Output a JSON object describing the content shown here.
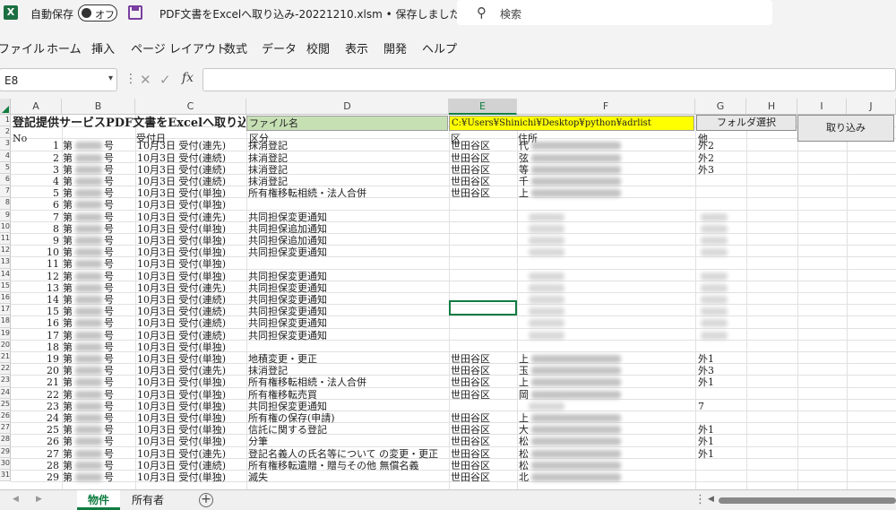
{
  "titlebar": {
    "app_icon": "excel-icon",
    "autosave_label": "自動保存",
    "autosave_state": "オフ",
    "save_icon": "save-icon",
    "document_title": "PDF文書をExcelへ取り込み-20221210.xlsm • 保存しました ∨",
    "search_placeholder": "検索"
  },
  "menu": [
    "ファイル",
    "ホーム",
    "挿入",
    "ページ レイアウト",
    "数式",
    "データ",
    "校閲",
    "表示",
    "開発",
    "ヘルプ"
  ],
  "formula_bar": {
    "name_box": "E8",
    "formula": ""
  },
  "columns": [
    "A",
    "B",
    "C",
    "D",
    "E",
    "F",
    "G",
    "H",
    "I",
    "J"
  ],
  "selected_column": "E",
  "row_numbers": [
    "1",
    "2",
    "3",
    "4",
    "5",
    "6",
    "7",
    "8",
    "9",
    "10",
    "11",
    "12",
    "13",
    "14",
    "15",
    "16",
    "17",
    "18",
    "19",
    "20",
    "21",
    "22",
    "23",
    "24",
    "25",
    "26",
    "27",
    "28",
    "29",
    "30",
    "31"
  ],
  "sheet": {
    "title": "登記提供サービスPDF文書をExcelへ取り込み",
    "filename_label": "ファイル名",
    "path_value": "C:¥Users¥Shinichi¥Desktop¥python¥adrlist",
    "folder_button": "フォルダ選択",
    "import_button": "取り込み",
    "headers": {
      "no": "No",
      "receipt": "受付日",
      "category": "区分",
      "ward": "区",
      "address": "住所",
      "other": "他"
    },
    "rows": [
      {
        "no": "1",
        "prefix": "第",
        "suffix": "号",
        "date": "10月3日 受付(連先)",
        "category": "抹消登記",
        "ward": "世田谷区",
        "addr": "代",
        "other": "外2"
      },
      {
        "no": "2",
        "prefix": "第",
        "suffix": "号",
        "date": "10月3日 受付(連続)",
        "category": "抹消登記",
        "ward": "世田谷区",
        "addr": "弦",
        "other": "外2"
      },
      {
        "no": "3",
        "prefix": "第",
        "suffix": "号",
        "date": "10月3日 受付(連続)",
        "category": "抹消登記",
        "ward": "世田谷区",
        "addr": "等",
        "other": "外3"
      },
      {
        "no": "4",
        "prefix": "第",
        "suffix": "号",
        "date": "10月3日 受付(連続)",
        "category": "抹消登記",
        "ward": "世田谷区",
        "addr": "千",
        "other": ""
      },
      {
        "no": "5",
        "prefix": "第",
        "suffix": "号",
        "date": "10月3日 受付(単独)",
        "category": "所有権移転相続・法人合併",
        "ward": "世田谷区",
        "addr": "上",
        "other": ""
      },
      {
        "no": "6",
        "prefix": "第",
        "suffix": "号",
        "date": "10月3日 受付(単独)",
        "category": "",
        "ward": "",
        "addr": "",
        "other": ""
      },
      {
        "no": "7",
        "prefix": "第",
        "suffix": "号",
        "date": "10月3日 受付(連先)",
        "category": "共同担保変更通知",
        "ward": "",
        "addr": "",
        "other": ""
      },
      {
        "no": "8",
        "prefix": "第",
        "suffix": "号",
        "date": "10月3日 受付(単独)",
        "category": "共同担保追加通知",
        "ward": "",
        "addr": "",
        "other": ""
      },
      {
        "no": "9",
        "prefix": "第",
        "suffix": "号",
        "date": "10月3日 受付(単独)",
        "category": "共同担保追加通知",
        "ward": "",
        "addr": "",
        "other": ""
      },
      {
        "no": "10",
        "prefix": "第",
        "suffix": "号",
        "date": "10月3日 受付(単独)",
        "category": "共同担保変更通知",
        "ward": "",
        "addr": "",
        "other": ""
      },
      {
        "no": "11",
        "prefix": "第",
        "suffix": "号",
        "date": "10月3日 受付(単独)",
        "category": "",
        "ward": "",
        "addr": "",
        "other": ""
      },
      {
        "no": "12",
        "prefix": "第",
        "suffix": "号",
        "date": "10月3日 受付(単独)",
        "category": "共同担保変更通知",
        "ward": "",
        "addr": "",
        "other": ""
      },
      {
        "no": "13",
        "prefix": "第",
        "suffix": "号",
        "date": "10月3日 受付(連先)",
        "category": "共同担保変更通知",
        "ward": "",
        "addr": "",
        "other": ""
      },
      {
        "no": "14",
        "prefix": "第",
        "suffix": "号",
        "date": "10月3日 受付(連続)",
        "category": "共同担保変更通知",
        "ward": "",
        "addr": "",
        "other": ""
      },
      {
        "no": "15",
        "prefix": "第",
        "suffix": "号",
        "date": "10月3日 受付(連続)",
        "category": "共同担保変更通知",
        "ward": "",
        "addr": "",
        "other": ""
      },
      {
        "no": "16",
        "prefix": "第",
        "suffix": "号",
        "date": "10月3日 受付(連続)",
        "category": "共同担保変更通知",
        "ward": "",
        "addr": "",
        "other": ""
      },
      {
        "no": "17",
        "prefix": "第",
        "suffix": "号",
        "date": "10月3日 受付(連続)",
        "category": "共同担保変更通知",
        "ward": "",
        "addr": "",
        "other": ""
      },
      {
        "no": "18",
        "prefix": "第",
        "suffix": "号",
        "date": "10月3日 受付(単独)",
        "category": "",
        "ward": "",
        "addr": "",
        "other": ""
      },
      {
        "no": "19",
        "prefix": "第",
        "suffix": "号",
        "date": "10月3日 受付(単独)",
        "category": "地積変更・更正",
        "ward": "世田谷区",
        "addr": "上",
        "other": "外1"
      },
      {
        "no": "20",
        "prefix": "第",
        "suffix": "号",
        "date": "10月3日 受付(連先)",
        "category": "抹消登記",
        "ward": "世田谷区",
        "addr": "玉",
        "other": "外3"
      },
      {
        "no": "21",
        "prefix": "第",
        "suffix": "号",
        "date": "10月3日 受付(単独)",
        "category": "所有権移転相続・法人合併",
        "ward": "世田谷区",
        "addr": "上",
        "other": "外1"
      },
      {
        "no": "22",
        "prefix": "第",
        "suffix": "号",
        "date": "10月3日 受付(単独)",
        "category": "所有権移転売買",
        "ward": "世田谷区",
        "addr": "岡",
        "other": ""
      },
      {
        "no": "23",
        "prefix": "第",
        "suffix": "号",
        "date": "10月3日 受付(単独)",
        "category": "共同担保変更通知",
        "ward": "",
        "addr": "",
        "other": "7"
      },
      {
        "no": "24",
        "prefix": "第",
        "suffix": "号",
        "date": "10月3日 受付(単独)",
        "category": "所有権の保存(申請)",
        "ward": "世田谷区",
        "addr": "上",
        "other": ""
      },
      {
        "no": "25",
        "prefix": "第",
        "suffix": "号",
        "date": "10月3日 受付(単独)",
        "category": "信託に関する登記",
        "ward": "世田谷区",
        "addr": "大",
        "other": "外1"
      },
      {
        "no": "26",
        "prefix": "第",
        "suffix": "号",
        "date": "10月3日 受付(単独)",
        "category": "分筆",
        "ward": "世田谷区",
        "addr": "松",
        "other": "外1"
      },
      {
        "no": "27",
        "prefix": "第",
        "suffix": "号",
        "date": "10月3日 受付(連先)",
        "category": "登記名義人の氏名等について の変更・更正",
        "ward": "世田谷区",
        "addr": "松",
        "other": "外1"
      },
      {
        "no": "28",
        "prefix": "第",
        "suffix": "号",
        "date": "10月3日 受付(連続)",
        "category": "所有権移転遺贈・贈与その他 無償名義",
        "ward": "世田谷区",
        "addr": "松",
        "other": ""
      },
      {
        "no": "29",
        "prefix": "第",
        "suffix": "号",
        "date": "10月3日 受付(単独)",
        "category": "滅失",
        "ward": "世田谷区",
        "addr": "北",
        "other": ""
      }
    ]
  },
  "sheet_tabs": [
    "物件",
    "所有者"
  ],
  "active_tab": "物件"
}
